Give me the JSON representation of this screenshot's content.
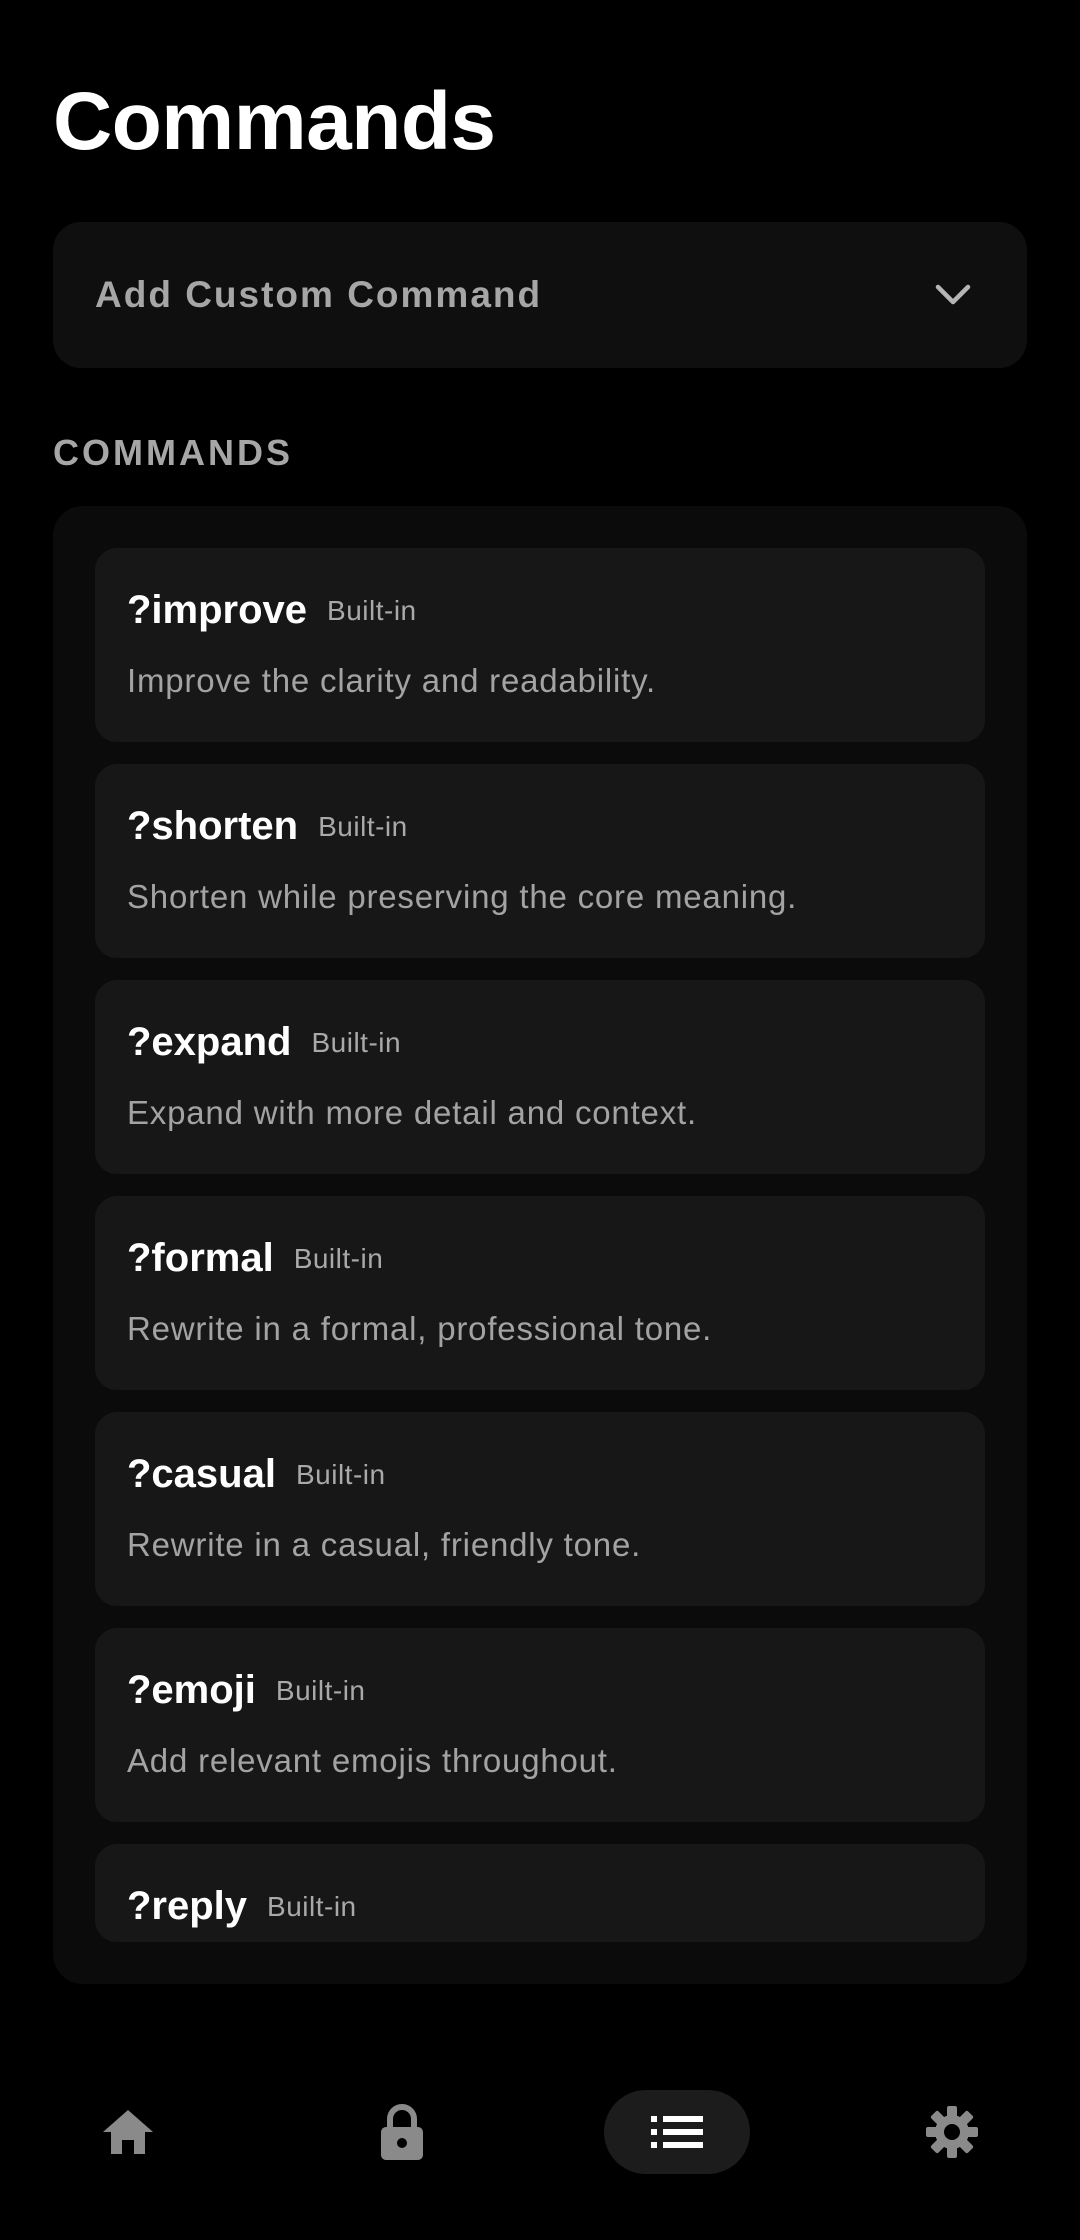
{
  "header": {
    "title": "Commands"
  },
  "add_custom": {
    "label": "Add Custom Command",
    "icon": "chevron-down-icon"
  },
  "section": {
    "title": "COMMANDS"
  },
  "commands": [
    {
      "name": "?improve",
      "badge": "Built-in",
      "description": "Improve the clarity and readability."
    },
    {
      "name": "?shorten",
      "badge": "Built-in",
      "description": "Shorten while preserving the core meaning."
    },
    {
      "name": "?expand",
      "badge": "Built-in",
      "description": "Expand with more detail and context."
    },
    {
      "name": "?formal",
      "badge": "Built-in",
      "description": "Rewrite in a formal, professional tone."
    },
    {
      "name": "?casual",
      "badge": "Built-in",
      "description": "Rewrite in a casual, friendly tone."
    },
    {
      "name": "?emoji",
      "badge": "Built-in",
      "description": "Add relevant emojis throughout."
    },
    {
      "name": "?reply",
      "badge": "Built-in"
    }
  ],
  "bottom_nav": {
    "items": [
      {
        "icon": "home-icon",
        "active": false
      },
      {
        "icon": "lock-icon",
        "active": false
      },
      {
        "icon": "list-icon",
        "active": true
      },
      {
        "icon": "gear-icon",
        "active": false
      }
    ]
  },
  "colors": {
    "background": "#000000",
    "card": "#171717",
    "panel": "#0b0b0b",
    "secondary_text": "#a3a3a3",
    "icon": "#8a8a8a",
    "active_icon": "#ffffff"
  }
}
